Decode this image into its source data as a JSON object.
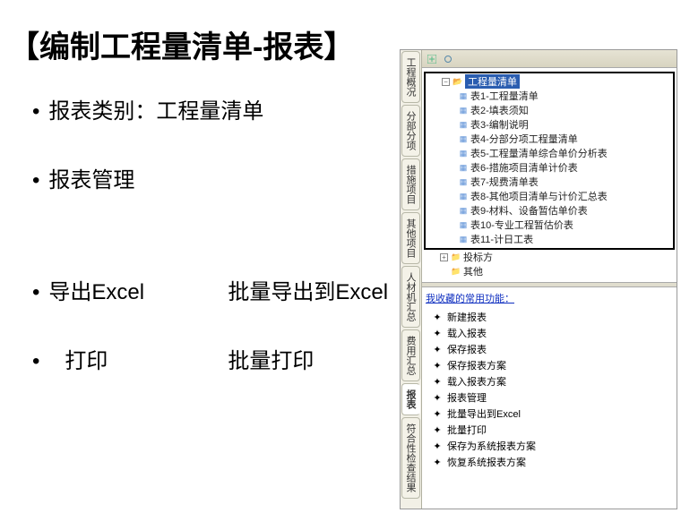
{
  "title": "【编制工程量清单-报表】",
  "bullets": {
    "b1": "报表类别：工程量清单",
    "b2": "报表管理",
    "b3a": "导出Excel",
    "b3b": "批量导出到Excel",
    "b4a": "打印",
    "b4b": "批量打印"
  },
  "vtabs": [
    "工程概况",
    "分部分项",
    "措施项目",
    "其他项目",
    "人材机汇总",
    "费用汇总",
    "报表",
    "符合性检查结果"
  ],
  "vtab_active_index": 6,
  "tree": {
    "root_label": "工程量清单",
    "items": [
      "表1-工程量清单",
      "表2-填表须知",
      "表3-编制说明",
      "表4-分部分项工程量清单",
      "表5-工程量清单综合单价分析表",
      "表6-措施项目清单计价表",
      "表7-规费清单表",
      "表8-其他项目清单与计价汇总表",
      "表9-材料、设备暂估单价表",
      "表10-专业工程暂估价表",
      "表11-计日工表"
    ],
    "siblings": [
      "投标方",
      "其他"
    ]
  },
  "fav_title": "我收藏的常用功能：",
  "fav_items": [
    "新建报表",
    "载入报表",
    "保存报表",
    "保存报表方案",
    "载入报表方案",
    "报表管理",
    "批量导出到Excel",
    "批量打印",
    "保存为系统报表方案",
    "恢复系统报表方案"
  ]
}
